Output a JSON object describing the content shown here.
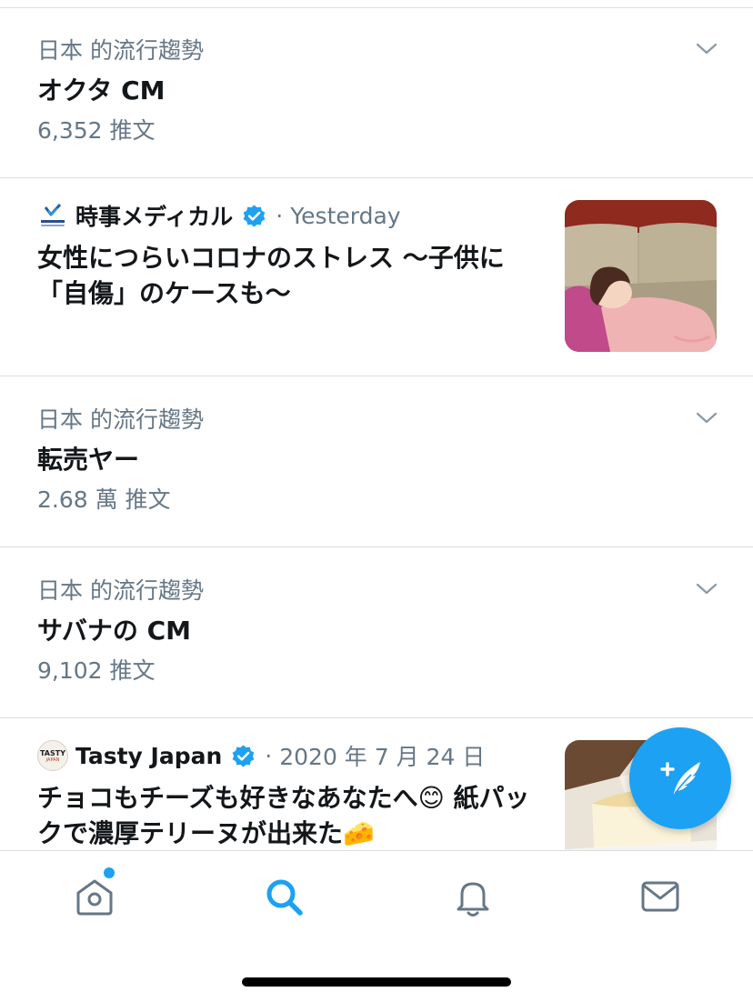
{
  "feed": {
    "trends": [
      {
        "context": "日本 的流行趨勢",
        "name": "オクタ CM",
        "count": "6,352 推文"
      },
      {
        "context": "日本 的流行趨勢",
        "name": "転売ヤー",
        "count": "2.68 萬 推文"
      },
      {
        "context": "日本 的流行趨勢",
        "name": "サバナの CM",
        "count": "9,102 推文"
      }
    ],
    "news": [
      {
        "source": "時事メディカル",
        "avatar_text": "時事メディカル",
        "separator": "·",
        "time": "Yesterday",
        "headline": "女性につらいコロナのストレス ～子供に「自傷」のケースも～",
        "thumbnail_icon": "illustration-woman-lying-on-sofa"
      },
      {
        "source": "Tasty Japan",
        "avatar_text": "TASTY",
        "avatar_subtext": "JAPAN",
        "separator": "·",
        "time": "2020 年 7 月 24 日",
        "headline": "チョコもチーズも好きなあなたへ😊 紙パックで濃厚テリーヌが出来た🧀",
        "thumbnail_icon": "cheesecake-photo"
      }
    ]
  },
  "fab": {
    "icon": "compose-tweet-icon"
  },
  "tabbar": {
    "items": [
      {
        "icon": "home-icon",
        "active": false,
        "has_notification_dot": true
      },
      {
        "icon": "search-icon",
        "active": true
      },
      {
        "icon": "notifications-bell-icon",
        "active": false
      },
      {
        "icon": "messages-mail-icon",
        "active": false
      }
    ]
  },
  "colors": {
    "accent": "#1da1f2",
    "text_primary": "#14171a",
    "text_secondary": "#657786",
    "divider": "#d9dde1",
    "icon_inactive": "#657786"
  }
}
